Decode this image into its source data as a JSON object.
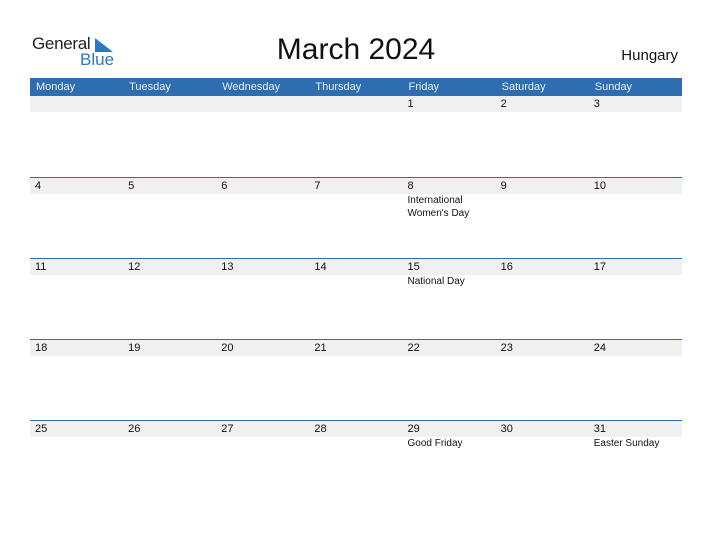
{
  "logo": {
    "line1": "General",
    "line2": "Blue",
    "accent": "#2a78c2"
  },
  "title": "March 2024",
  "country": "Hungary",
  "colors": {
    "header_bg": "#2e6db0",
    "date_band": "#f0f0f0"
  },
  "weekdays": [
    "Monday",
    "Tuesday",
    "Wednesday",
    "Thursday",
    "Friday",
    "Saturday",
    "Sunday"
  ],
  "weeks": [
    {
      "days": [
        "",
        "",
        "",
        "",
        "1",
        "2",
        "3"
      ],
      "events": [
        "",
        "",
        "",
        "",
        "",
        "",
        ""
      ]
    },
    {
      "days": [
        "4",
        "5",
        "6",
        "7",
        "8",
        "9",
        "10"
      ],
      "events": [
        "",
        "",
        "",
        "",
        "International Women's Day",
        "",
        ""
      ]
    },
    {
      "days": [
        "11",
        "12",
        "13",
        "14",
        "15",
        "16",
        "17"
      ],
      "events": [
        "",
        "",
        "",
        "",
        "National Day",
        "",
        ""
      ]
    },
    {
      "days": [
        "18",
        "19",
        "20",
        "21",
        "22",
        "23",
        "24"
      ],
      "events": [
        "",
        "",
        "",
        "",
        "",
        "",
        ""
      ]
    },
    {
      "days": [
        "25",
        "26",
        "27",
        "28",
        "29",
        "30",
        "31"
      ],
      "events": [
        "",
        "",
        "",
        "",
        "Good Friday",
        "",
        "Easter Sunday"
      ]
    }
  ]
}
